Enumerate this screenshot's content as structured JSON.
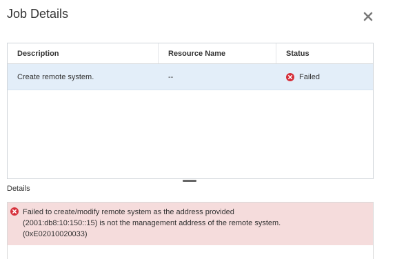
{
  "dialog": {
    "title": "Job Details",
    "close_icon": "close-icon"
  },
  "grid": {
    "columns": [
      {
        "label": "Description"
      },
      {
        "label": "Resource Name"
      },
      {
        "label": "Status"
      }
    ],
    "rows": [
      {
        "description": "Create remote system.",
        "resource_name": "--",
        "status": "Failed",
        "status_icon": "error-icon",
        "selected": true
      }
    ]
  },
  "details": {
    "label": "Details",
    "message_lines": [
      "Failed to create/modify remote system as the address provided",
      "(2001:db8:10:150::15) is not the management address of the remote system.",
      "(0xE02010020033)"
    ],
    "message_icon": "error-icon"
  },
  "colors": {
    "selected_row": "#e3eef9",
    "error_bg": "#f5dcdc",
    "error_icon": "#d6303b"
  }
}
